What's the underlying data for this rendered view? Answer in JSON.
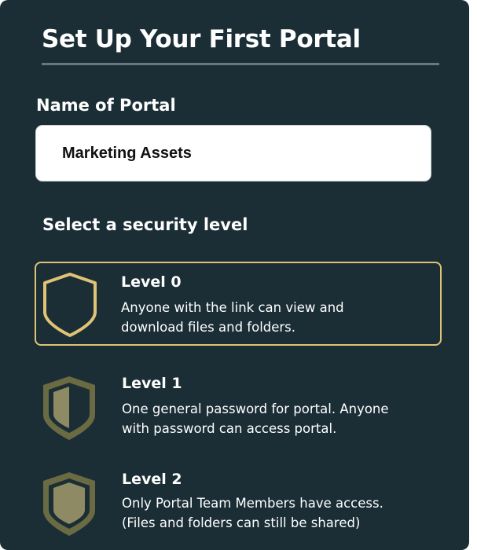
{
  "header": {
    "title": "Set Up Your First Portal"
  },
  "portal_name": {
    "label": "Name of Portal",
    "value": "Marketing Assets"
  },
  "security": {
    "heading": "Select a security level",
    "selected": "Level 0",
    "levels": [
      {
        "title": "Level 0",
        "description_lines": [
          "Anyone with the link can view and",
          "download files and folders."
        ],
        "icon": "shield-outline-icon"
      },
      {
        "title": "Level 1",
        "description_lines": [
          "One general password for portal. Anyone",
          "with password can access portal."
        ],
        "icon": "shield-half-filled-icon"
      },
      {
        "title": "Level 2",
        "description_lines": [
          "Only Portal Team Members have access.",
          "(Files and folders can still be shared)"
        ],
        "icon": "shield-filled-icon"
      }
    ]
  },
  "colors": {
    "panel_background": "#1b2e36",
    "selected_accent": "#e0c375",
    "shield_olive": "#6a6a43",
    "shield_fill": "#8e8a63"
  }
}
